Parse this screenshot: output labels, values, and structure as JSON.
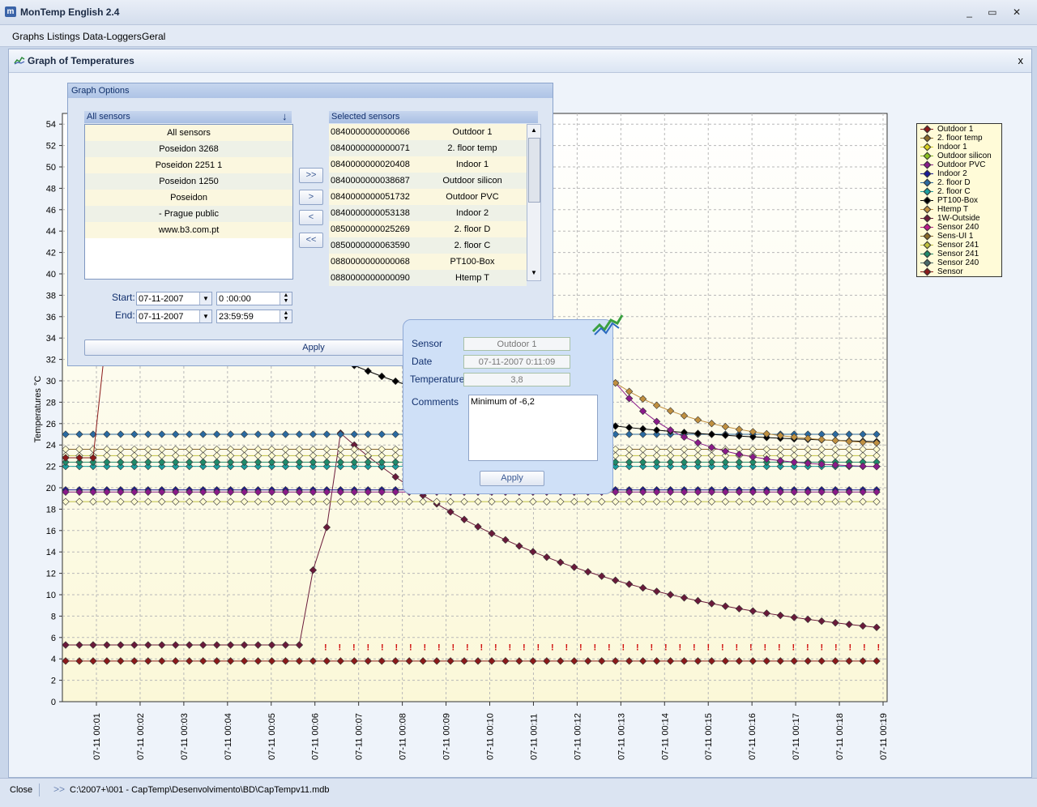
{
  "app": {
    "title": "MonTemp English   2.4",
    "controls": "_ ▭ ✕"
  },
  "menu": [
    "Graphs",
    "Listings",
    "Data-Loggers",
    "Geral"
  ],
  "child_window": {
    "title": "Graph of Temperatures",
    "close": "x"
  },
  "graph_options": {
    "title": "Graph Options",
    "all_header": "All sensors",
    "all_sensors": [
      "All sensors",
      "Poseidon 3268",
      "Poseidon 2251 1",
      "Poseidon 1250",
      "Poseidon",
      "- Prague public",
      "www.b3.com.pt"
    ],
    "selected_header": "Selected sensors",
    "selected_sensors": [
      {
        "id": "0840000000000066",
        "name": "Outdoor 1"
      },
      {
        "id": "0840000000000071",
        "name": "2. floor temp"
      },
      {
        "id": "0840000000020408",
        "name": "Indoor 1"
      },
      {
        "id": "0840000000038687",
        "name": "Outdoor silicon"
      },
      {
        "id": "0840000000051732",
        "name": "Outdoor PVC"
      },
      {
        "id": "0840000000053138",
        "name": "Indoor 2"
      },
      {
        "id": "0850000000025269",
        "name": "2. floor D"
      },
      {
        "id": "0850000000063590",
        "name": "2. floor C"
      },
      {
        "id": "0880000000000068",
        "name": "PT100-Box"
      },
      {
        "id": "0880000000000090",
        "name": "Htemp T"
      }
    ],
    "buttons": {
      "add_all": ">>",
      "add": ">",
      "remove": "<",
      "remove_all": "<<",
      "apply": "Apply"
    },
    "start_label": "Start:",
    "end_label": "End:",
    "start_date": "07-11-2007",
    "start_time": "0 :00:00",
    "end_date": "07-11-2007",
    "end_time": "23:59:59"
  },
  "popup": {
    "sensor_label": "Sensor",
    "sensor_value": "Outdoor 1",
    "date_label": "Date",
    "date_value": "07-11-2007 0:11:09",
    "temp_label": "Temperature",
    "temp_value": "3,8",
    "comments_label": "Comments",
    "comments_value": "Minimum of -6,2",
    "apply": "Apply"
  },
  "status": {
    "close": "Close",
    "arrows": ">>",
    "path": "C:\\2007+\\001 - CapTemp\\Desenvolvimento\\BD\\CapTempv11.mdb"
  },
  "chart_data": {
    "type": "line",
    "ylabel": "Temperatures °C",
    "xlabel": "",
    "ylim": [
      0,
      55
    ],
    "yticks": [
      0,
      2,
      4,
      6,
      8,
      10,
      12,
      14,
      16,
      18,
      20,
      22,
      24,
      26,
      28,
      30,
      32,
      34,
      36,
      38,
      40,
      42,
      44,
      46,
      48,
      50,
      52,
      54
    ],
    "categories": [
      "07-11 00:01",
      "07-11 00:02",
      "07-11 00:03",
      "07-11 00:04",
      "07-11 00:05",
      "07-11 00:06",
      "07-11 00:07",
      "07-11 00:08",
      "07-11 00:09",
      "07-11 00:10",
      "07-11 00:11",
      "07-11 00:12",
      "07-11 00:13",
      "07-11 00:14",
      "07-11 00:15",
      "07-11 00:16",
      "07-11 00:17",
      "07-11 00:18",
      "07-11 00:19"
    ],
    "grid": true,
    "legend_position": "right",
    "series": [
      {
        "name": "Outdoor 1",
        "color": "#8b1a1a"
      },
      {
        "name": "2. floor temp",
        "color": "#8b6b2a"
      },
      {
        "name": "Indoor 1",
        "color": "#d8d020"
      },
      {
        "name": "Outdoor silicon",
        "color": "#8abf20"
      },
      {
        "name": "Outdoor PVC",
        "color": "#8a1a8a"
      },
      {
        "name": "Indoor 2",
        "color": "#1a1a9a"
      },
      {
        "name": "2. floor D",
        "color": "#2a6aa0"
      },
      {
        "name": "2. floor C",
        "color": "#1aa0a0"
      },
      {
        "name": "PT100-Box",
        "color": "#000000"
      },
      {
        "name": "Htemp T",
        "color": "#c09040"
      },
      {
        "name": "1W-Outside",
        "color": "#6a1a3a"
      },
      {
        "name": "Sensor 240",
        "color": "#c01a8a"
      },
      {
        "name": "Sens-UI 1",
        "color": "#8a6a2a"
      },
      {
        "name": "Sensor 241",
        "color": "#c0c040"
      },
      {
        "name": "Sensor 241",
        "color": "#208a6a"
      },
      {
        "name": "Sensor 240",
        "color": "#4a6a6a"
      },
      {
        "name": "Sensor",
        "color": "#8a1a1a"
      }
    ]
  }
}
